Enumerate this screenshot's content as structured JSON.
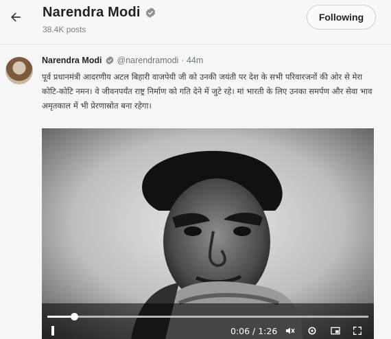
{
  "header": {
    "name": "Narendra Modi",
    "posts": "38.4K posts",
    "follow_label": "Following"
  },
  "tweet": {
    "author": "Narendra Modi",
    "handle": "@narendramodi",
    "time": "· 44m",
    "text": "पूर्व प्रधानमंत्री आदरणीय अटल बिहारी वाजपेयी जी को उनकी जयंती पर देश के सभी परिवारजनों की ओर से मेरा कोटि-कोटि नमन। वे जीवनपर्यंत राष्ट्र निर्माण को गति देने में जुटे रहे। मां भारती के लिए उनका समर्पण और सेवा भाव अमृतकाल में भी प्रेरणास्रोत बना रहेगा।"
  },
  "video": {
    "time_display": "0:06 / 1:26",
    "progress_fraction": 0.085
  },
  "icons": [
    "back-arrow-icon",
    "verified-badge-icon",
    "pause-icon",
    "volume-icon",
    "settings-icon",
    "picture-in-picture-icon",
    "fullscreen-icon"
  ],
  "colors": {
    "verified": "#1d9bf0",
    "video_bg": "#0d0d0d"
  }
}
